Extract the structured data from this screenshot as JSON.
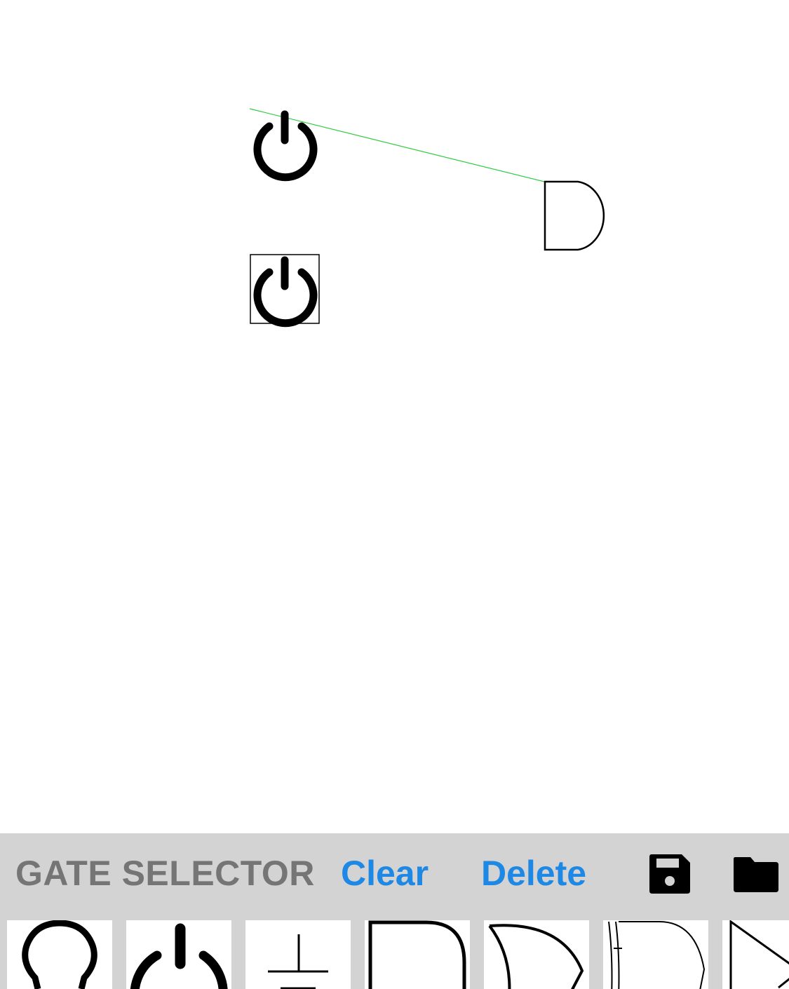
{
  "canvas": {
    "components": [
      {
        "type": "power-switch",
        "selected": false
      },
      {
        "type": "power-switch",
        "selected": true
      },
      {
        "type": "and-gate",
        "selected": false
      }
    ],
    "wires": [
      {
        "from": "power-switch",
        "to": "and-gate",
        "color": "#2ecc40"
      }
    ]
  },
  "toolbar": {
    "title": "GATE SELECTOR",
    "clear_label": "Clear",
    "delete_label": "Delete",
    "save_icon": "save-icon",
    "open_icon": "folder-icon"
  },
  "gate_palette": [
    {
      "name": "light-bulb",
      "icon": "light-bulb-icon"
    },
    {
      "name": "power-switch",
      "icon": "power-icon"
    },
    {
      "name": "ground",
      "icon": "ground-icon"
    },
    {
      "name": "and-gate",
      "icon": "and-gate-icon"
    },
    {
      "name": "or-gate",
      "icon": "or-gate-icon"
    },
    {
      "name": "xor-gate",
      "icon": "xor-gate-icon"
    },
    {
      "name": "buffer",
      "icon": "buffer-icon"
    }
  ],
  "colors": {
    "accent": "#1e88e5",
    "title": "#757575",
    "panel": "#d3d3d3",
    "wire": "#2ecc40"
  }
}
